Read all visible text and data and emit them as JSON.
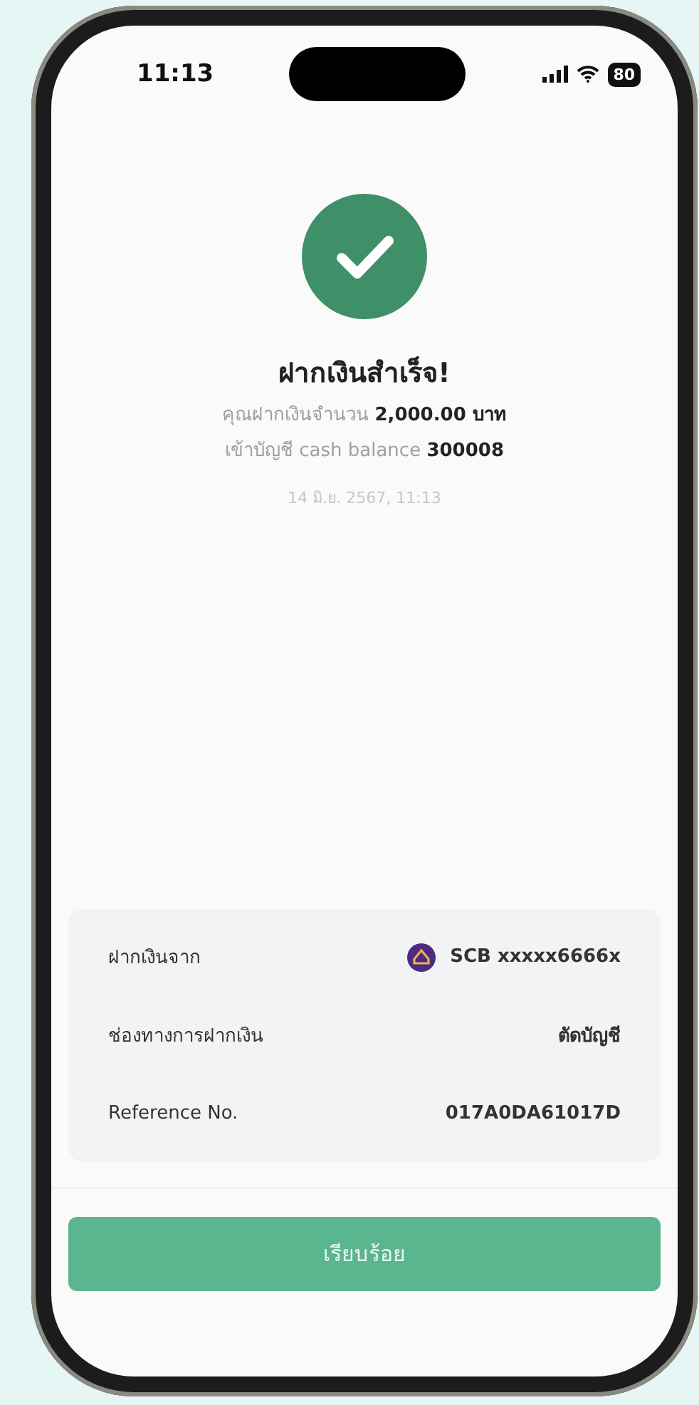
{
  "status_bar": {
    "time": "11:13",
    "battery": "80"
  },
  "result": {
    "title": "ฝากเงินสำเร็จ!",
    "lines": [
      "คุณฝากเงินจำนวน **2,000.00 บาท**",
      "เข้าบัญชี cash balance **300008**"
    ],
    "date": "14 มิ.ย. 2567, 11:13"
  },
  "details": [
    {
      "kind": "bank",
      "label": "ฝากเงินจาก",
      "value": "SCB xxxxx6666x"
    },
    {
      "kind": "text",
      "label": "ช่องทางการฝากเงิน",
      "value": "ตัดบัญชี"
    },
    {
      "kind": "text",
      "label": "Reference No.",
      "value": "017A0DA61017D"
    }
  ],
  "button": {
    "label": "เรียบร้อย"
  }
}
